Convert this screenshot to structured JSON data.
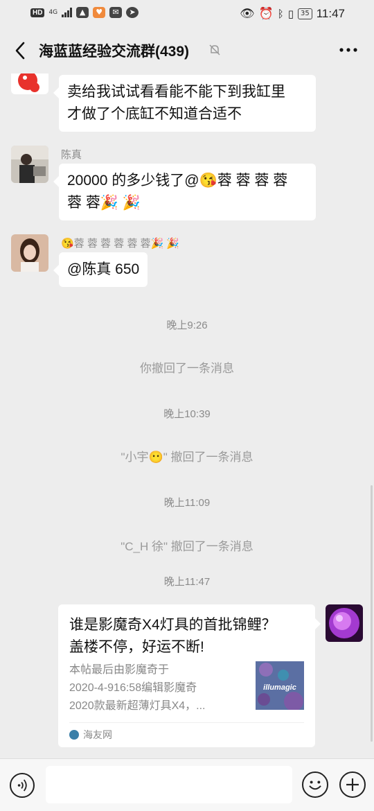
{
  "status_bar": {
    "left_badge": "HD",
    "network": "4G",
    "battery": "35",
    "time": "11:47"
  },
  "header": {
    "title": "海蓝蓝经验交流群(439)",
    "back_icon": "chevron-left-icon",
    "mute_icon": "bell-off-icon",
    "more_icon": "more-dots-icon"
  },
  "messages": [
    {
      "sender": "",
      "text_lines": [
        "卖给我试试看看能不能下到我缸里",
        "才做了个底缸不知道合适不"
      ]
    },
    {
      "sender": "陈真",
      "text_lines": [
        "20000 的多少钱了@😘蓉 蓉 蓉 蓉",
        "蓉 蓉🎉 🎉"
      ]
    },
    {
      "sender": "😘蓉 蓉 蓉 蓉 蓉 蓉🎉 🎉",
      "text_lines": [
        "@陈真  650"
      ]
    }
  ],
  "system": {
    "time1": "晚上9:26",
    "recall1": "你撤回了一条消息",
    "time2": "晚上10:39",
    "recall2": "\"小宇😶\" 撤回了一条消息",
    "time3": "晚上11:09",
    "recall3": "\"C_H 徐\" 撤回了一条消息",
    "time4": "晚上11:47"
  },
  "link_card": {
    "title_line1": "谁是影魔奇X4灯具的首批锦鲤？",
    "title_line2": "盖楼不停，好运不断!",
    "desc_line1": "本帖最后由影魔奇于",
    "desc_line2": "2020-4-916:58编辑影魔奇",
    "desc_line3": "2020款最新超薄灯具X4，...",
    "thumb_text": "illumagic",
    "source": "海友网"
  },
  "input_bar": {
    "voice_icon": "voice-icon",
    "emoji_icon": "emoji-icon",
    "plus_icon": "plus-icon"
  }
}
